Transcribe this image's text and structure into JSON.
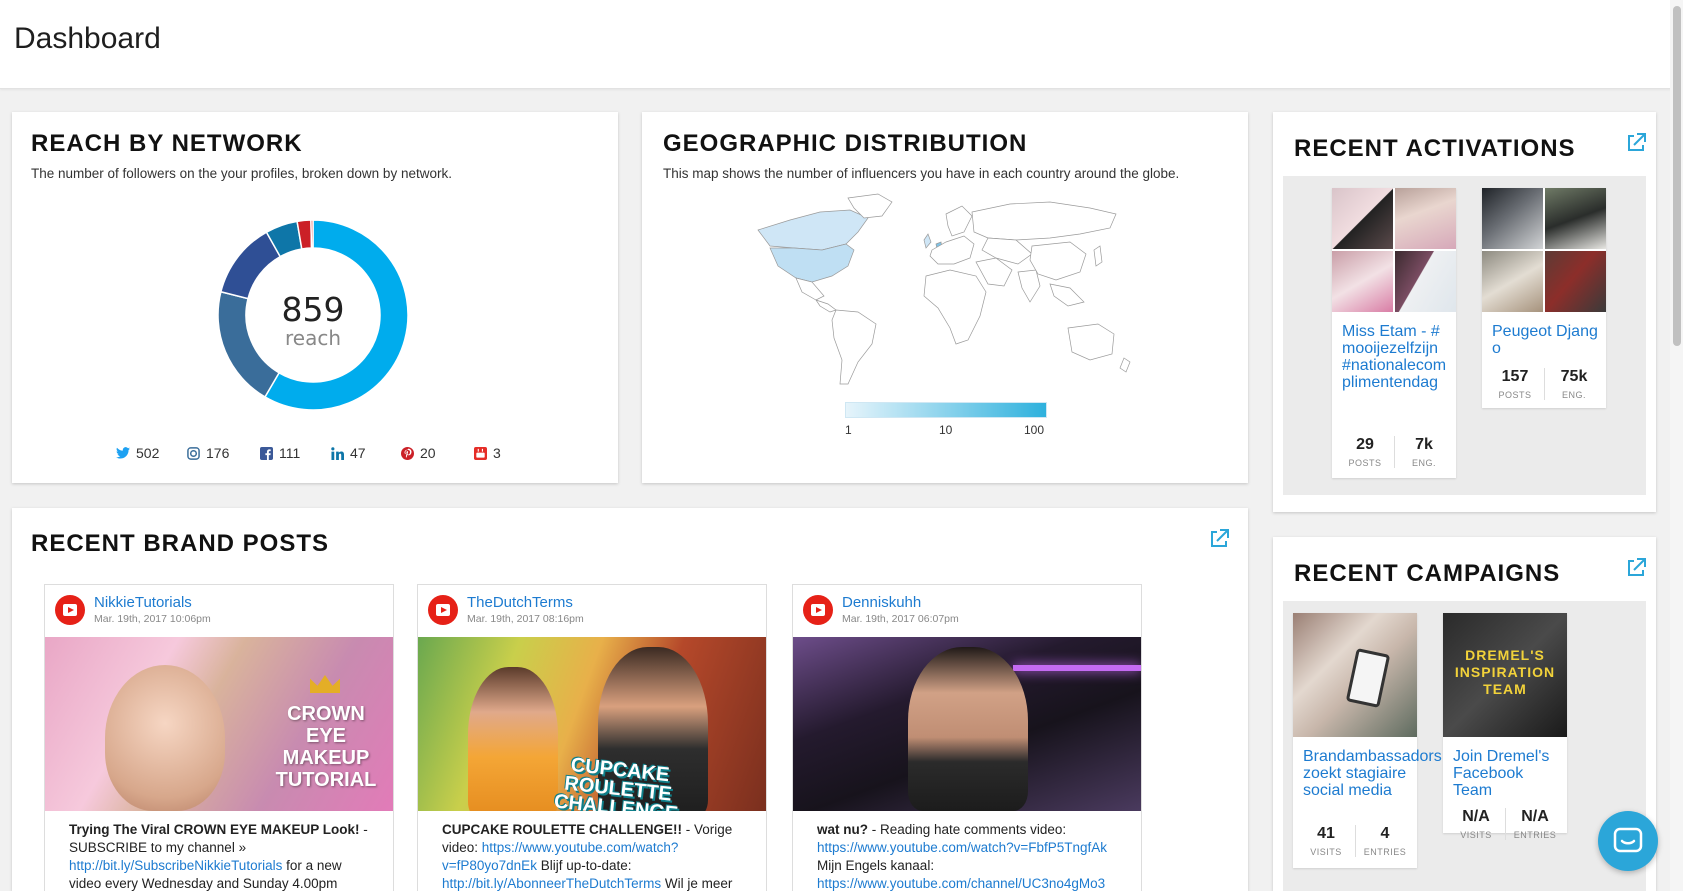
{
  "header": {
    "title": "Dashboard"
  },
  "reach": {
    "title": "REACH BY NETWORK",
    "subtitle": "The number of followers on the your profiles, broken down by network.",
    "total": "859",
    "total_label": "reach",
    "networks": [
      {
        "icon": "twitter-icon",
        "value": "502",
        "color": "#00aced"
      },
      {
        "icon": "instagram-icon",
        "value": "176",
        "color": "#3a6d9a"
      },
      {
        "icon": "facebook-icon",
        "value": "111",
        "color": "#3b5998"
      },
      {
        "icon": "linkedin-icon",
        "value": "47",
        "color": "#0e76a8"
      },
      {
        "icon": "pinterest-icon",
        "value": "20",
        "color": "#cb2027"
      },
      {
        "icon": "youtube-icon",
        "value": "3",
        "color": "#e52d27"
      }
    ]
  },
  "chart_data": {
    "type": "pie",
    "categories": [
      "Twitter",
      "Instagram",
      "Facebook",
      "LinkedIn",
      "Pinterest",
      "YouTube"
    ],
    "values": [
      502,
      176,
      111,
      47,
      20,
      3
    ]
  },
  "geo": {
    "title": "GEOGRAPHIC DISTRIBUTION",
    "subtitle": "This map shows the number of influencers you have in each country around the globe.",
    "scale_labels": [
      "1",
      "10",
      "100"
    ]
  },
  "activations": {
    "title": "RECENT ACTIVATIONS",
    "items": [
      {
        "title": "Miss Etam - #mooijezelfzijn #nationalecomplimentendag",
        "posts": "29",
        "posts_label": "POSTS",
        "eng": "7k",
        "eng_label": "ENG."
      },
      {
        "title": "Peugeot Django",
        "posts": "157",
        "posts_label": "POSTS",
        "eng": "75k",
        "eng_label": "ENG."
      }
    ]
  },
  "campaigns": {
    "title": "RECENT CAMPAIGNS",
    "items": [
      {
        "title": "Brandambassadors zoekt stagiaire social media",
        "visits": "41",
        "visits_label": "VISITS",
        "entries": "4",
        "entries_label": "ENTRIES",
        "image_text": ""
      },
      {
        "title": "Join Dremel's Facebook Team",
        "visits": "N/A",
        "visits_label": "VISITS",
        "entries": "N/A",
        "entries_label": "ENTRIES",
        "image_text": "DREMEL'S INSPIRATION TEAM"
      }
    ]
  },
  "posts": {
    "title": "RECENT BRAND POSTS",
    "items": [
      {
        "author": "NikkieTutorials",
        "date": "Mar. 19th, 2017 10:06pm",
        "text_bold": "Trying The Viral CROWN EYE MAKEUP Look!",
        "text_1": " - SUBSCRIBE to my channel » ",
        "link": "http://bit.ly/SubscribeNikkieTutorials",
        "text_2": " for a new video every Wednesday and Sunday 4.00pm",
        "thumb_text": "CROWN EYE MAKEUP TUTORIAL"
      },
      {
        "author": "TheDutchTerms",
        "date": "Mar. 19th, 2017 08:16pm",
        "text_bold": "CUPCAKE ROULETTE CHALLENGE!!",
        "text_1": " - Vorige video: ",
        "link": "https://www.youtube.com/watch?v=fP80yo7dnEk",
        "text_2": " Blijf up-to-date: ",
        "link2": "http://bit.ly/AbonneerTheDutchTerms",
        "text_3": " Wil je meer",
        "thumb_text": "CUPCAKE ROULETTE CHALLENGE"
      },
      {
        "author": "Denniskuhh",
        "date": "Mar. 19th, 2017 06:07pm",
        "text_bold": "wat nu?",
        "text_1": " - Reading hate comments video: ",
        "link": "https://www.youtube.com/watch?v=FbfP5TngfAk",
        "text_2": " Mijn Engels kanaal: ",
        "link2": "https://www.youtube.com/channel/UC3no4gMo3"
      }
    ]
  }
}
